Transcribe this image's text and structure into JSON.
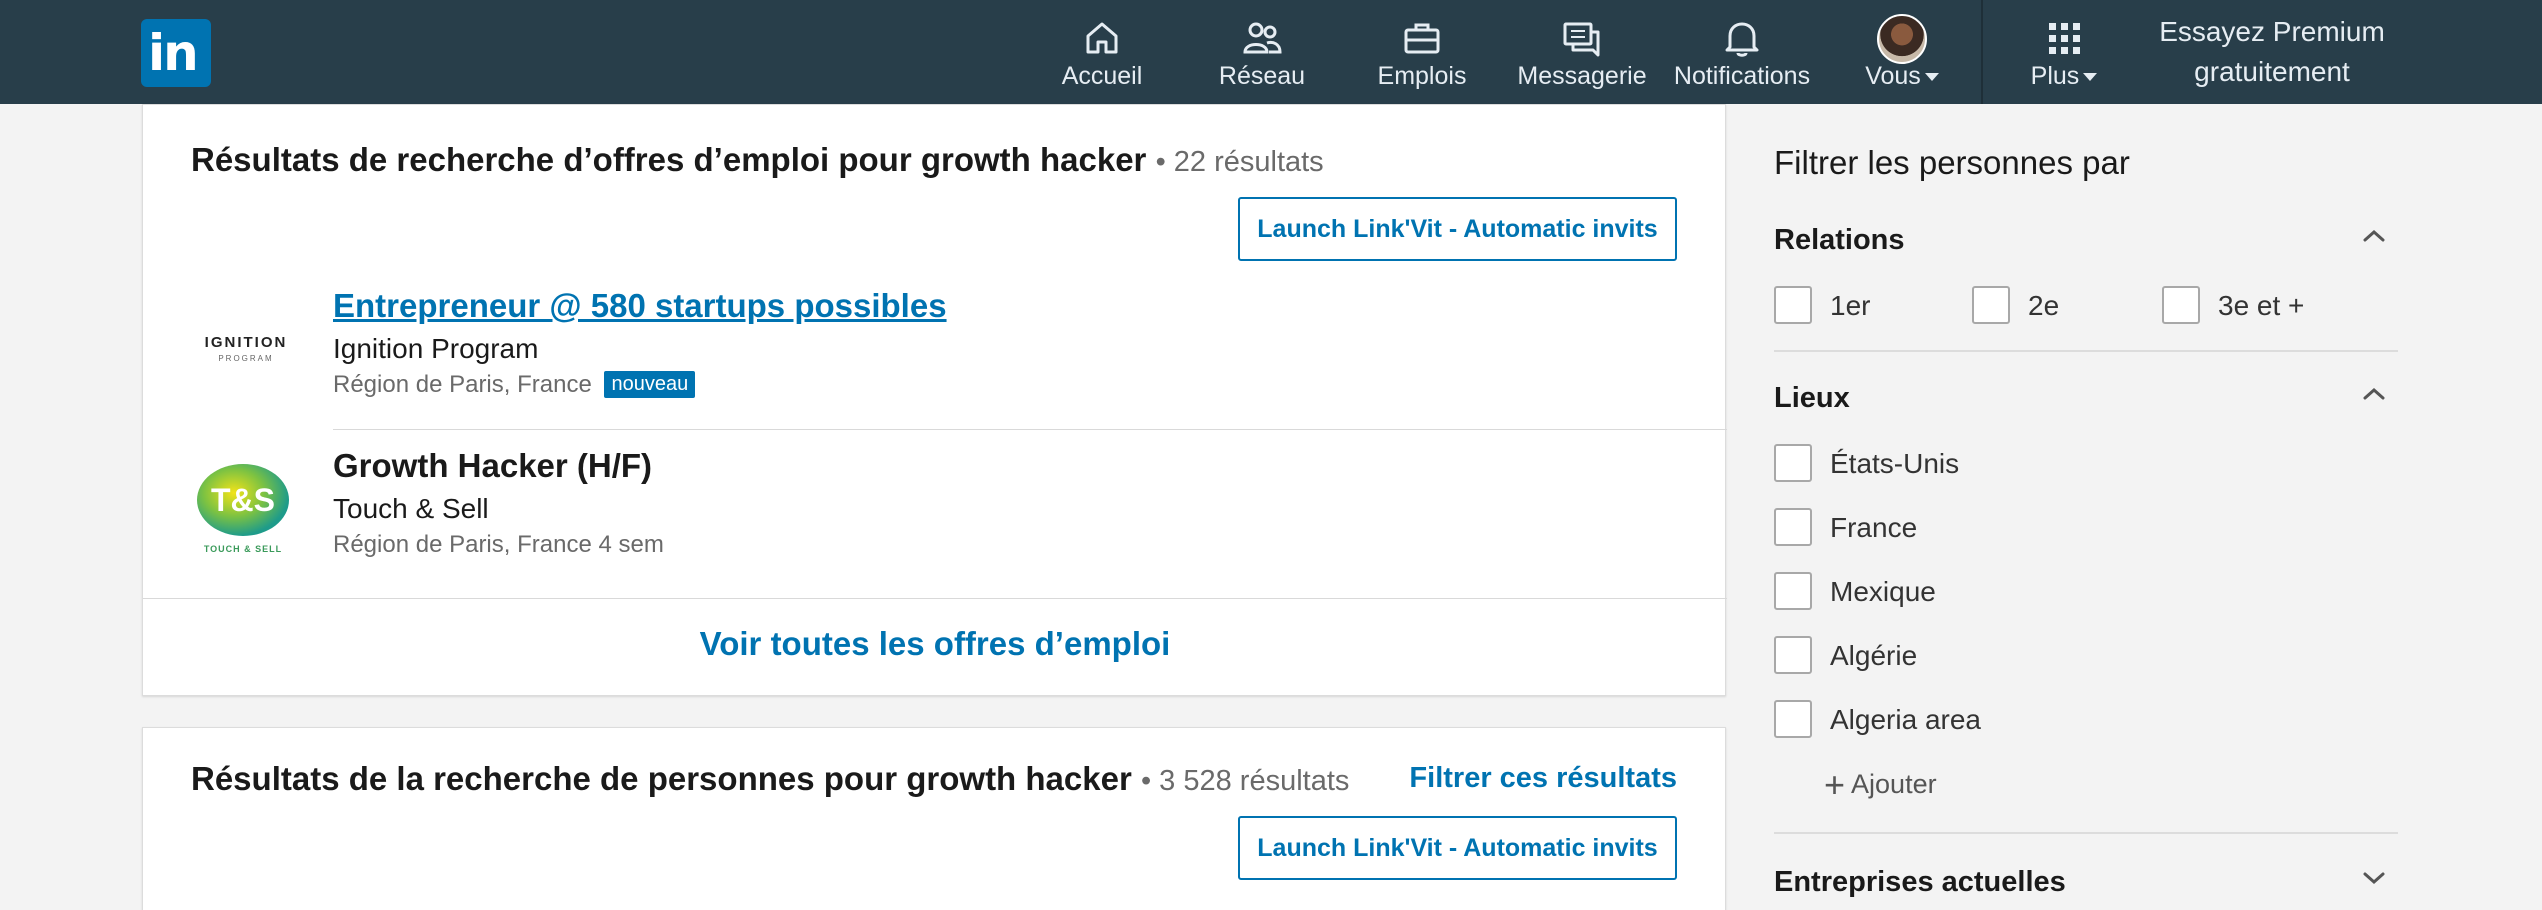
{
  "nav": {
    "logo_text": "in",
    "items": [
      {
        "label": "Accueil",
        "icon": "home-icon"
      },
      {
        "label": "Réseau",
        "icon": "network-icon"
      },
      {
        "label": "Emplois",
        "icon": "briefcase-icon"
      },
      {
        "label": "Messagerie",
        "icon": "messaging-icon"
      },
      {
        "label": "Notifications",
        "icon": "bell-icon"
      },
      {
        "label": "Vous",
        "icon": "avatar"
      },
      {
        "label": "Plus",
        "icon": "grid-icon"
      }
    ],
    "premium_line1": "Essayez Premium",
    "premium_line2": "gratuitement"
  },
  "jobs": {
    "heading": "Résultats de recherche d’offres d’emploi pour growth hacker",
    "count": "• 22 résultats",
    "linkvit_label": "Launch Link'Vit - Automatic invits",
    "items": [
      {
        "title": "Entrepreneur @ 580 startups possibles",
        "company": "Ignition Program",
        "location": "Région de Paris, France",
        "badge": "nouveau",
        "logo_text": "IGNITION",
        "logo_sub": "PROGRAM"
      },
      {
        "title": "Growth Hacker (H/F)",
        "company": "Touch & Sell",
        "location": "Région de Paris, France",
        "age": "4 sem",
        "logo_text": "T&S",
        "logo_sub": "TOUCH & SELL"
      }
    ],
    "see_all": "Voir toutes les offres d’emploi"
  },
  "people": {
    "heading": "Résultats de la recherche de personnes pour growth hacker",
    "count": "• 3 528 résultats",
    "filter_link": "Filtrer ces résultats",
    "linkvit_label": "Launch Link'Vit - Automatic invits"
  },
  "filters": {
    "title": "Filtrer les personnes par",
    "relations": {
      "title": "Relations",
      "options": [
        "1er",
        "2e",
        "3e et +"
      ]
    },
    "lieux": {
      "title": "Lieux",
      "options": [
        "États-Unis",
        "France",
        "Mexique",
        "Algérie",
        "Algeria area"
      ],
      "add_label": "Ajouter"
    },
    "companies": {
      "title": "Entreprises actuelles"
    }
  },
  "colors": {
    "nav_bg": "#283e4a",
    "brand": "#0073b1",
    "page_bg": "#f3f3f3"
  }
}
